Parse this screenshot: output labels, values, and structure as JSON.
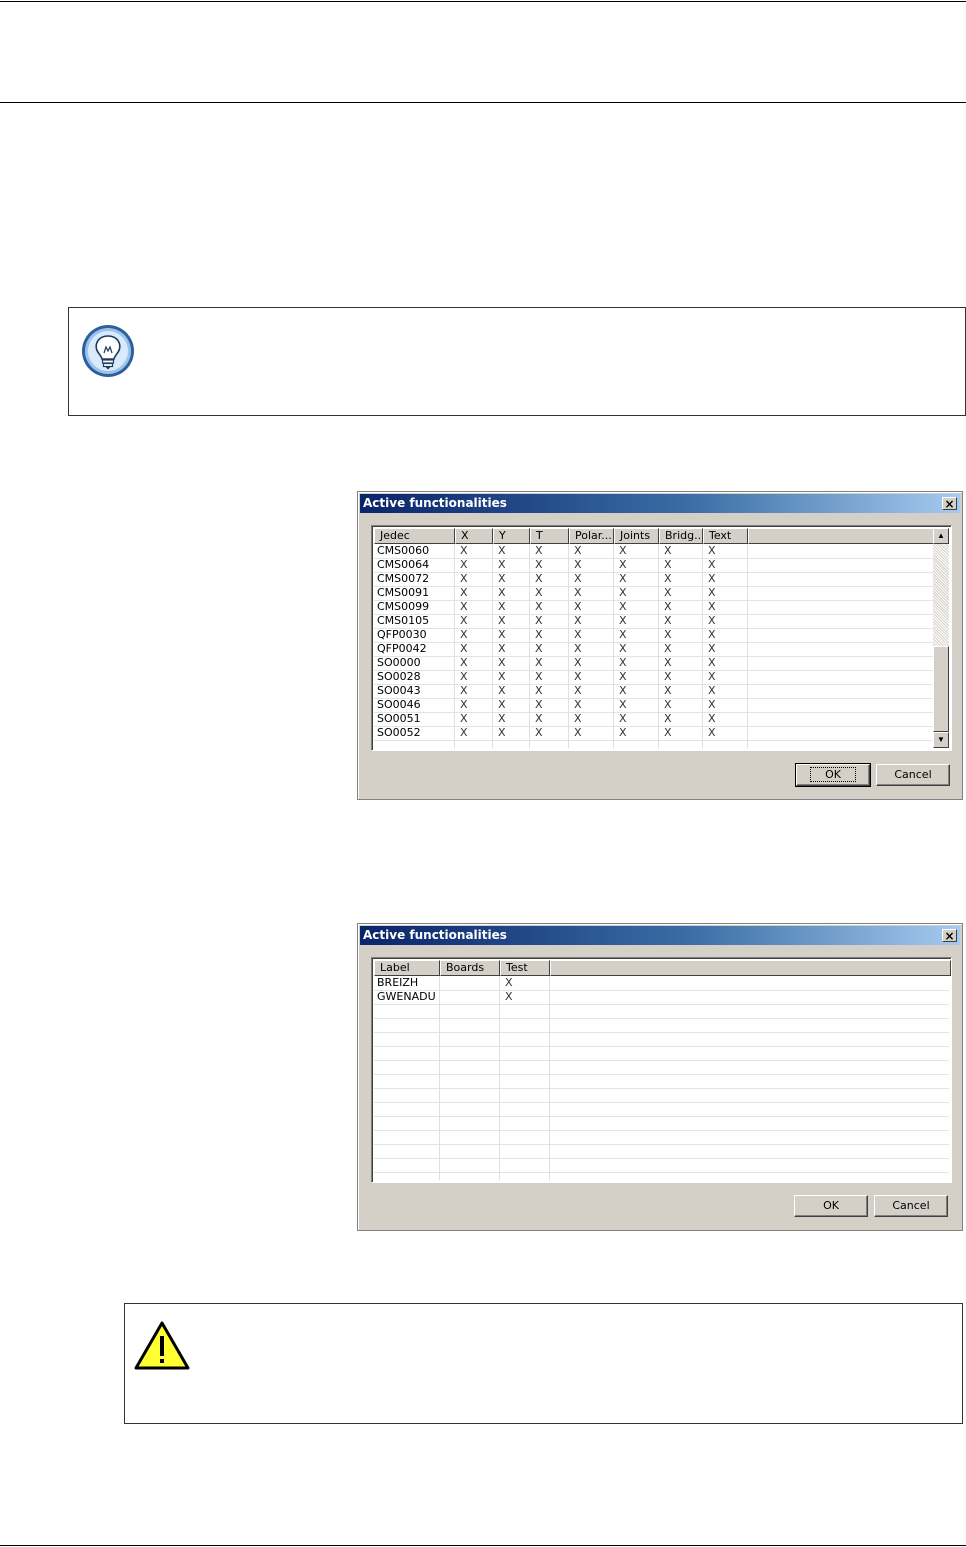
{
  "dialog1": {
    "title": "Active functionalities",
    "close_glyph": "×",
    "columns": [
      "Jedec",
      "X",
      "Y",
      "T",
      "Polar...",
      "Joints",
      "Bridg...",
      "Text"
    ],
    "rows": [
      [
        "CMS0060",
        "X",
        "X",
        "X",
        "X",
        "X",
        "X",
        "X"
      ],
      [
        "CMS0064",
        "X",
        "X",
        "X",
        "X",
        "X",
        "X",
        "X"
      ],
      [
        "CMS0072",
        "X",
        "X",
        "X",
        "X",
        "X",
        "X",
        "X"
      ],
      [
        "CMS0091",
        "X",
        "X",
        "X",
        "X",
        "X",
        "X",
        "X"
      ],
      [
        "CMS0099",
        "X",
        "X",
        "X",
        "X",
        "X",
        "X",
        "X"
      ],
      [
        "CMS0105",
        "X",
        "X",
        "X",
        "X",
        "X",
        "X",
        "X"
      ],
      [
        "QFP0030",
        "X",
        "X",
        "X",
        "X",
        "X",
        "X",
        "X"
      ],
      [
        "QFP0042",
        "X",
        "X",
        "X",
        "X",
        "X",
        "X",
        "X"
      ],
      [
        "SO0000",
        "X",
        "X",
        "X",
        "X",
        "X",
        "X",
        "X"
      ],
      [
        "SO0028",
        "X",
        "X",
        "X",
        "X",
        "X",
        "X",
        "X"
      ],
      [
        "SO0043",
        "X",
        "X",
        "X",
        "X",
        "X",
        "X",
        "X"
      ],
      [
        "SO0046",
        "X",
        "X",
        "X",
        "X",
        "X",
        "X",
        "X"
      ],
      [
        "SO0051",
        "X",
        "X",
        "X",
        "X",
        "X",
        "X",
        "X"
      ],
      [
        "SO0052",
        "X",
        "X",
        "X",
        "X",
        "X",
        "X",
        "X"
      ]
    ],
    "ok_label": "OK",
    "cancel_label": "Cancel",
    "scroll_up_glyph": "▲",
    "scroll_down_glyph": "▼"
  },
  "dialog2": {
    "title": "Active functionalities",
    "close_glyph": "×",
    "columns": [
      "Label",
      "Boards",
      "Test"
    ],
    "rows": [
      [
        "BREIZH",
        "",
        "X"
      ],
      [
        "GWENADU",
        "",
        "X"
      ]
    ],
    "ok_label": "OK",
    "cancel_label": "Cancel"
  },
  "icons": {
    "tip": "lightbulb-icon",
    "warning": "warning-icon",
    "warning_color": "#ffff33",
    "tip_color": "#4a7fc0"
  }
}
